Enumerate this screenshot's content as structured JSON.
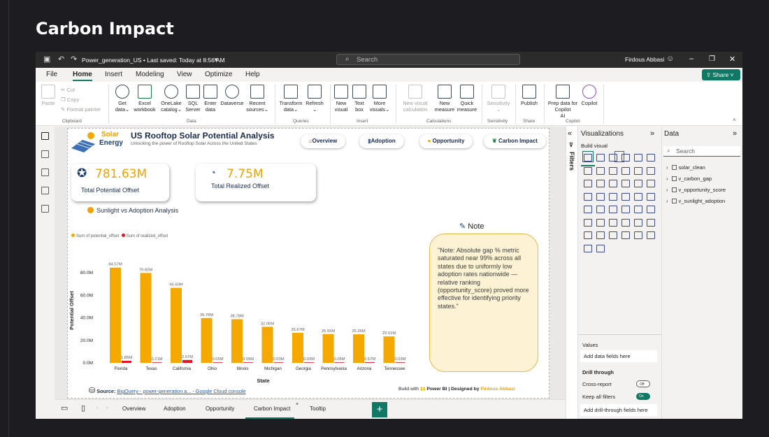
{
  "page_heading": "Carbon Impact",
  "titlebar": {
    "doc_title": "Power_generation_US • Last saved: Today at 8:56 AM",
    "search_placeholder": "Search",
    "user_name": "Firdous Abbasi"
  },
  "menu": {
    "items": [
      "File",
      "Home",
      "Insert",
      "Modeling",
      "View",
      "Optimize",
      "Help"
    ],
    "active": "Home",
    "share_label": "Share"
  },
  "ribbon": {
    "clipboard": {
      "paste": "Paste",
      "cut": "Cut",
      "copy": "Copy",
      "format_painter": "Format painter",
      "label": "Clipboard"
    },
    "data": {
      "get_data": [
        "Get",
        "data"
      ],
      "excel": [
        "Excel",
        "workbook"
      ],
      "onelake": [
        "OneLake",
        "catalog"
      ],
      "sql": [
        "SQL",
        "Server"
      ],
      "enter": [
        "Enter",
        "data"
      ],
      "dataverse": [
        "Dataverse",
        ""
      ],
      "recent": [
        "Recent",
        "sources"
      ],
      "label": "Data"
    },
    "queries": {
      "transform": [
        "Transform",
        "data"
      ],
      "refresh": [
        "Refresh",
        ""
      ],
      "label": "Queries"
    },
    "insert": {
      "new_visual": [
        "New",
        "visual"
      ],
      "text_box": [
        "Text",
        "box"
      ],
      "more_visuals": [
        "More",
        "visuals"
      ],
      "label": "Insert"
    },
    "calculations": {
      "new_visual_calc": [
        "New visual",
        "calculation"
      ],
      "new_measure": [
        "New",
        "measure"
      ],
      "quick_measure": [
        "Quick",
        "measure"
      ],
      "label": "Calculations"
    },
    "sensitivity": {
      "sensitivity": [
        "Sensitivity",
        ""
      ],
      "label": "Sensitivity"
    },
    "share": {
      "publish": [
        "Publish",
        ""
      ],
      "label": "Share"
    },
    "copilot": {
      "prep": [
        "Prep data for Copilot",
        "AI"
      ],
      "copilot": [
        "Copilot",
        ""
      ],
      "label": "Copilot"
    }
  },
  "report": {
    "logo_line1": "Solar",
    "logo_line2": "Energy",
    "title": "US Rooftop Solar Potential Analysis",
    "subtitle": "Unlocking the power of Rooftop Solar Across the United States",
    "nav_buttons": [
      "Overview",
      "Adoption",
      "Opportunity",
      "Carbon Impact"
    ],
    "kpi1": {
      "value": "781.63M",
      "label": "Total Potential Offset"
    },
    "kpi2": {
      "value": "7.75M",
      "label": "Total Realized Offset"
    },
    "section_title": "Sunlight vs Adoption Analysis",
    "note_title": "Note",
    "note_text": "\"Note: Absolute gap % metric saturated near 99% across all states due to uniformly low adoption rates nationwide — relative ranking (opportunity_score) proved more effective for identifying priority states.\"",
    "source_label": "Source:",
    "source_link": "BigQuery - power-generation a... - Google Cloud console",
    "built_with": "Build with",
    "power_bi": "Power BI",
    "designed_by": "| Designed by",
    "designer": "Firdous Abbasi"
  },
  "chart_data": {
    "type": "bar",
    "categories": [
      "Florida",
      "Texas",
      "California",
      "Ohio",
      "Illinois",
      "Michigan",
      "Georgia",
      "Pennsylvania",
      "Arizona",
      "Tennessee"
    ],
    "series": [
      {
        "name": "Sum of potential_offset",
        "values": [
          84.57,
          79.82,
          66.6,
          39.78,
          38.78,
          32.06,
          26.67,
          25.55,
          25.36,
          23.51
        ],
        "labels": [
          "84.57M",
          "79.82M",
          "66.60M",
          "39.78M",
          "38.78M",
          "32.06M",
          "26.67M",
          "25.55M",
          "25.36M",
          "23.51M"
        ],
        "color": "#f5a800"
      },
      {
        "name": "Sum of realized_offset",
        "values": [
          1.85,
          0.21,
          2.57,
          0.05,
          0.09,
          0.03,
          0.03,
          0.06,
          0.57,
          0.03
        ],
        "labels": [
          "1.85M",
          "0.21M",
          "2.57M",
          "0.05M",
          "0.09M",
          "0.03M",
          "0.03M",
          "0.06M",
          "0.57M",
          "0.03M"
        ],
        "color": "#e81123"
      }
    ],
    "ylabel": "Potential Offset",
    "xlabel": "State",
    "yticks": [
      "0.0M",
      "20.0M",
      "40.0M",
      "60.0M",
      "80.0M"
    ],
    "ylim": [
      0,
      90
    ]
  },
  "tabs": {
    "items": [
      "Overview",
      "Adoption",
      "Opportunity",
      "Carbon Impact",
      "Tooltip"
    ],
    "active": "Carbon Impact",
    "add": "+"
  },
  "filters_label": "Filters",
  "viz_pane": {
    "title": "Visualizations",
    "build_visual": "Build visual",
    "values_label": "Values",
    "values_placeholder": "Add data fields here",
    "drill_through": "Drill through",
    "cross_report": "Cross-report",
    "cross_report_state": "Off",
    "keep_all_filters": "Keep all filters",
    "keep_all_filters_state": "On",
    "drill_placeholder": "Add drill-through fields here"
  },
  "data_pane": {
    "title": "Data",
    "search_placeholder": "Search",
    "tables": [
      "solar_clean",
      "v_carbon_gap",
      "v_opportunity_score",
      "v_sunlight_adoption"
    ]
  }
}
